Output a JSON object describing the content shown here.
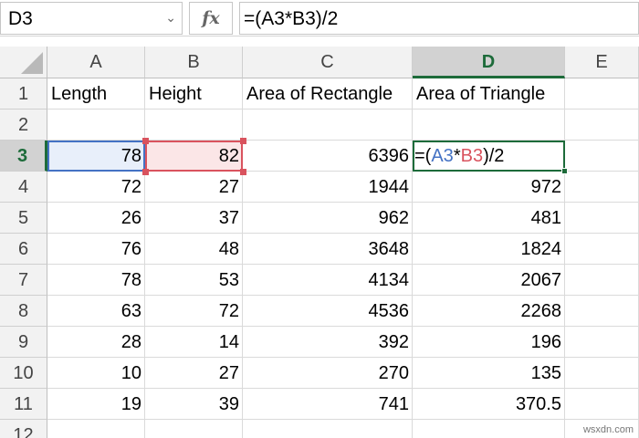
{
  "formula_bar": {
    "name_box": "D3",
    "fx_label": "fx",
    "formula": "=(A3*B3)/2",
    "formula_parts": [
      "=(",
      "A3",
      "*",
      "B3",
      ")/2"
    ]
  },
  "columns": [
    "A",
    "B",
    "C",
    "D",
    "E"
  ],
  "active_column": "D",
  "rows": [
    "1",
    "2",
    "3",
    "4",
    "5",
    "6",
    "7",
    "8",
    "9",
    "10",
    "11",
    "12"
  ],
  "active_row": "3",
  "headers": {
    "A": "Length",
    "B": "Height",
    "C": "Area of Rectangle",
    "D": "Area of Triangle"
  },
  "data_rows": [
    {
      "row": "3",
      "A": "78",
      "B": "82",
      "C": "6396",
      "D": ""
    },
    {
      "row": "4",
      "A": "72",
      "B": "27",
      "C": "1944",
      "D": "972"
    },
    {
      "row": "5",
      "A": "26",
      "B": "37",
      "C": "962",
      "D": "481"
    },
    {
      "row": "6",
      "A": "76",
      "B": "48",
      "C": "3648",
      "D": "1824"
    },
    {
      "row": "7",
      "A": "78",
      "B": "53",
      "C": "4134",
      "D": "2067"
    },
    {
      "row": "8",
      "A": "63",
      "B": "72",
      "C": "4536",
      "D": "2268"
    },
    {
      "row": "9",
      "A": "28",
      "B": "14",
      "C": "392",
      "D": "196"
    },
    {
      "row": "10",
      "A": "10",
      "B": "27",
      "C": "270",
      "D": "135"
    },
    {
      "row": "11",
      "A": "19",
      "B": "39",
      "C": "741",
      "D": "370.5"
    }
  ],
  "editing_cell": {
    "ref": "D3",
    "parts": [
      "=(",
      "A3",
      "*",
      "B3",
      ")/2"
    ]
  },
  "watermark": "wsxdn.com",
  "colors": {
    "excel_green": "#1d6b3a",
    "ref_blue": "#4472c4",
    "ref_red": "#d9535e"
  }
}
